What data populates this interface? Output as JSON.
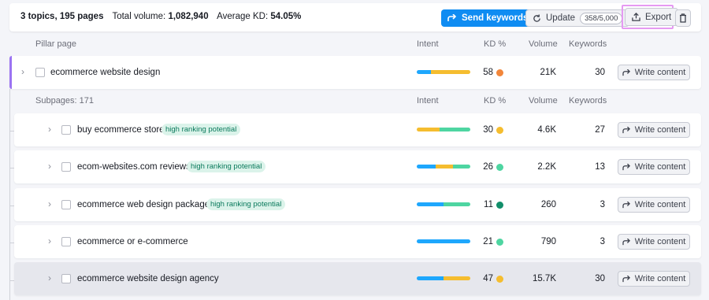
{
  "summary": {
    "topics_pages": "3 topics, 195 pages",
    "total_volume_label": "Total volume:",
    "total_volume_value": "1,082,940",
    "avg_kd_label": "Average KD:",
    "avg_kd_value": "54.05%"
  },
  "toolbar": {
    "send_keywords": "Send keywords",
    "update": "Update",
    "update_counter": "358/5,000",
    "export": "Export"
  },
  "pillar_header": {
    "pillar_page": "Pillar page",
    "intent": "Intent",
    "kd": "KD %",
    "volume": "Volume",
    "keywords": "Keywords"
  },
  "pillar_row": {
    "keyword": "ecommerce website design",
    "kd": "58",
    "kd_color": "#f2863a",
    "intent": [
      {
        "color": "#1ea7fd",
        "fraction": 0.27
      },
      {
        "color": "#f5bd2f",
        "fraction": 0.73
      }
    ],
    "volume": "21K",
    "keywords": "30",
    "write": "Write content"
  },
  "sub_header": {
    "subpages": "Subpages: 171",
    "intent": "Intent",
    "kd": "KD %",
    "volume": "Volume",
    "keywords": "Keywords"
  },
  "subpages": [
    {
      "keyword": "buy ecommerce store",
      "badge": "high ranking potential",
      "kd": "30",
      "kd_color": "#f5bd2f",
      "intent": [
        {
          "color": "#f5bd2f",
          "fraction": 0.42
        },
        {
          "color": "#4ed5a1",
          "fraction": 0.58
        }
      ],
      "volume": "4.6K",
      "keywords": "27",
      "write": "Write content"
    },
    {
      "keyword": "ecom-websites.com reviews",
      "badge": "high ranking potential",
      "kd": "26",
      "kd_color": "#4ed5a1",
      "intent": [
        {
          "color": "#1ea7fd",
          "fraction": 0.36
        },
        {
          "color": "#f5bd2f",
          "fraction": 0.32
        },
        {
          "color": "#4ed5a1",
          "fraction": 0.32
        }
      ],
      "volume": "2.2K",
      "keywords": "13",
      "write": "Write content"
    },
    {
      "keyword": "ecommerce web design packages",
      "badge": "high ranking potential",
      "kd": "11",
      "kd_color": "#128e6a",
      "intent": [
        {
          "color": "#1ea7fd",
          "fraction": 0.5
        },
        {
          "color": "#4ed5a1",
          "fraction": 0.5
        }
      ],
      "volume": "260",
      "keywords": "3",
      "write": "Write content"
    },
    {
      "keyword": "ecommerce or e-commerce",
      "badge": "",
      "kd": "21",
      "kd_color": "#4ed5a1",
      "intent": [
        {
          "color": "#1ea7fd",
          "fraction": 1.0
        }
      ],
      "volume": "790",
      "keywords": "3",
      "write": "Write content"
    },
    {
      "keyword": "ecommerce website design agency",
      "badge": "",
      "kd": "47",
      "kd_color": "#f5bd2f",
      "intent": [
        {
          "color": "#1ea7fd",
          "fraction": 0.5
        },
        {
          "color": "#f5bd2f",
          "fraction": 0.5
        }
      ],
      "volume": "15.7K",
      "keywords": "30",
      "write": "Write content"
    }
  ]
}
